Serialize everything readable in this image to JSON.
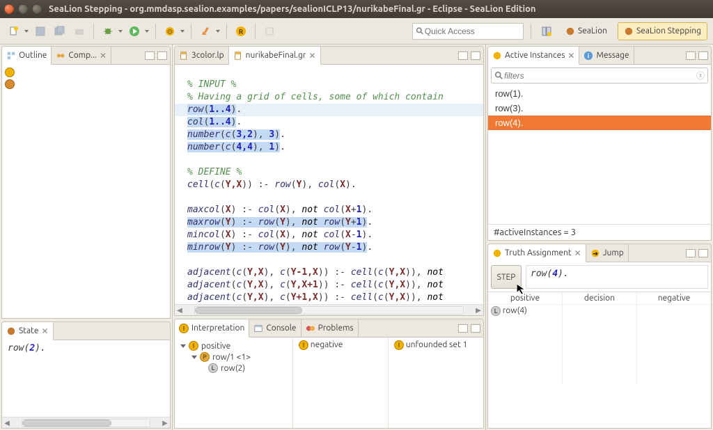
{
  "window": {
    "title": "SeaLion Stepping - org.mmdasp.sealion.examples/papers/sealionICLP13/nurikabeFinal.gr - Eclipse - SeaLion Edition"
  },
  "toolbar": {
    "quick_access_placeholder": "Quick Access",
    "perspective1": "SeaLion",
    "perspective2": "SeaLion Stepping"
  },
  "left": {
    "tab_outline": "Outline",
    "tab_comp": "Comp..."
  },
  "editor": {
    "tab1": "3color.lp",
    "tab2": "nurikabeFinal.gr",
    "line1": "% INPUT %",
    "line2": "% Having a grid of cells, some of which contain",
    "row_pred": "row",
    "row_range": "1..4",
    "col_pred": "col",
    "col_range": "1..4",
    "num1_a": "number",
    "num1_b": "c",
    "num1_c": "3,2",
    "num1_d": "3",
    "num2_a": "number",
    "num2_b": "c",
    "num2_c": "4,4",
    "num2_d": "1",
    "define": "% DEFINE %",
    "cell_a": "cell",
    "cell_b": "c",
    "cell_yx": "Y,X",
    "cell_row": "row",
    "cell_y": "Y",
    "cell_col": "col",
    "cell_x": "X",
    "maxcol_a": "maxcol",
    "maxcol_x": "X",
    "maxcol_col": "col",
    "maxcol_not": "not",
    "maxcol_xp1": "X+1",
    "maxrow_a": "maxrow",
    "maxrow_y": "Y",
    "maxrow_row": "row",
    "maxrow_yp1": "Y+1",
    "mincol_a": "mincol",
    "mincol_xm1": "X-1",
    "minrow_a": "minrow",
    "minrow_ym1": "Y-1",
    "adj": "adjacent",
    "adj_c": "c",
    "adj_yx": "Y,X",
    "adj_ym1x": "Y-1,X",
    "adj_yxp1": "Y,X+1",
    "adj_yp1x": "Y+1,X",
    "adj_cell": "cell",
    "adj_not": "not"
  },
  "active": {
    "view_title": "Active Instances",
    "msg_tab": "Message",
    "filter_placeholder": "filters",
    "items": [
      "row(1).",
      "row(3).",
      "row(4)."
    ],
    "selected_index": 2,
    "status": "#activeInstances = 3"
  },
  "truth": {
    "view_title": "Truth Assignment",
    "jump_tab": "Jump",
    "step": "STEP",
    "expr_a": "row",
    "expr_b": "4",
    "col_positive": "positive",
    "col_decision": "decision",
    "col_negative": "negative",
    "positive_item": "row(4)"
  },
  "bottom": {
    "state_tab": "State",
    "interp_tab": "Interpretation",
    "console_tab": "Console",
    "problems_tab": "Problems",
    "state_expr_a": "row",
    "state_expr_b": "2",
    "tree_positive": "positive",
    "tree_row1": "row/1 <1>",
    "tree_row2": "row(2)",
    "col_negative": "negative",
    "col_unfounded": "unfounded set 1"
  }
}
